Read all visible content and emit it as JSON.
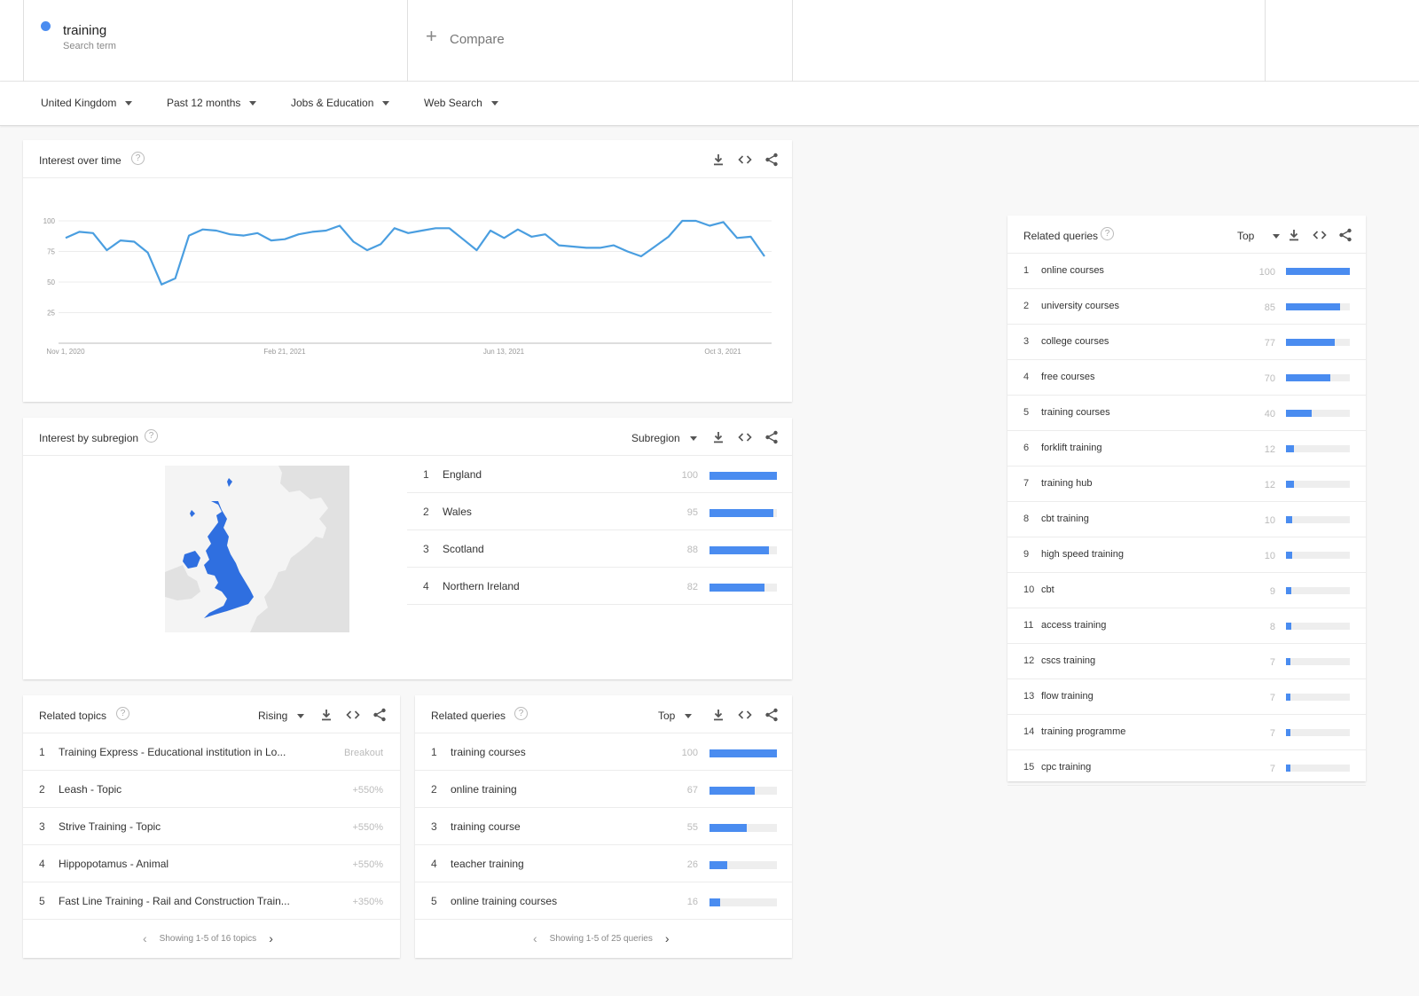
{
  "search": {
    "term": "training",
    "term_sub": "Search term",
    "compare_plus": "+",
    "compare_label": "Compare",
    "term_color": "#4a8cf0"
  },
  "filters": {
    "region": "United Kingdom",
    "period": "Past 12 months",
    "category": "Jobs & Education",
    "search_type": "Web Search"
  },
  "icons": {
    "help": "?",
    "download": "download-icon",
    "embed": "embed-icon",
    "share": "share-icon"
  },
  "interest_over_time": {
    "title": "Interest over time",
    "chart_data": {
      "type": "line",
      "x_tick_labels": [
        "Nov 1, 2020",
        "Feb 21, 2021",
        "Jun 13, 2021",
        "Oct 3, 2021"
      ],
      "y_tick_labels": [
        "100",
        "75",
        "50",
        "25"
      ],
      "ylim": [
        0,
        100
      ],
      "grid": true,
      "color": "#4a9ee0",
      "values": [
        86,
        91,
        90,
        76,
        84,
        83,
        74,
        48,
        53,
        88,
        93,
        92,
        89,
        88,
        90,
        84,
        85,
        89,
        91,
        92,
        96,
        83,
        76,
        81,
        94,
        90,
        92,
        94,
        94,
        85,
        76,
        92,
        86,
        93,
        87,
        89,
        80,
        79,
        78,
        78,
        80,
        75,
        71,
        79,
        87,
        100,
        100,
        96,
        99,
        86,
        87,
        71
      ]
    }
  },
  "interest_by_subregion": {
    "title": "Interest by subregion",
    "dropdown": "Subregion",
    "rows": [
      {
        "rank": "1",
        "name": "England",
        "value": "100",
        "score": 100
      },
      {
        "rank": "2",
        "name": "Wales",
        "value": "95",
        "score": 95
      },
      {
        "rank": "3",
        "name": "Scotland",
        "value": "88",
        "score": 88
      },
      {
        "rank": "4",
        "name": "Northern Ireland",
        "value": "82",
        "score": 82
      }
    ]
  },
  "related_topics": {
    "title": "Related topics",
    "dropdown": "Rising",
    "rows": [
      {
        "rank": "1",
        "name": "Training Express - Educational institution in Lo...",
        "value": "Breakout"
      },
      {
        "rank": "2",
        "name": "Leash - Topic",
        "value": "+550%"
      },
      {
        "rank": "3",
        "name": "Strive Training - Topic",
        "value": "+550%"
      },
      {
        "rank": "4",
        "name": "Hippopotamus - Animal",
        "value": "+550%"
      },
      {
        "rank": "5",
        "name": "Fast Line Training - Rail and Construction Train...",
        "value": "+350%"
      }
    ],
    "pager": "Showing 1-5 of 16 topics"
  },
  "related_queries_small": {
    "title": "Related queries",
    "dropdown": "Top",
    "rows": [
      {
        "rank": "1",
        "name": "training courses",
        "value": "100",
        "score": 100
      },
      {
        "rank": "2",
        "name": "online training",
        "value": "67",
        "score": 67
      },
      {
        "rank": "3",
        "name": "training course",
        "value": "55",
        "score": 55
      },
      {
        "rank": "4",
        "name": "teacher training",
        "value": "26",
        "score": 26
      },
      {
        "rank": "5",
        "name": "online training courses",
        "value": "16",
        "score": 16
      }
    ],
    "pager": "Showing 1-5 of 25 queries"
  },
  "related_queries_large": {
    "title": "Related queries",
    "dropdown": "Top",
    "rows": [
      {
        "rank": "1",
        "name": "online courses",
        "value": "100",
        "score": 100
      },
      {
        "rank": "2",
        "name": "university courses",
        "value": "85",
        "score": 85
      },
      {
        "rank": "3",
        "name": "college courses",
        "value": "77",
        "score": 77
      },
      {
        "rank": "4",
        "name": "free courses",
        "value": "70",
        "score": 70
      },
      {
        "rank": "5",
        "name": "training courses",
        "value": "40",
        "score": 40
      },
      {
        "rank": "6",
        "name": "forklift training",
        "value": "12",
        "score": 12
      },
      {
        "rank": "7",
        "name": "training hub",
        "value": "12",
        "score": 12
      },
      {
        "rank": "8",
        "name": "cbt training",
        "value": "10",
        "score": 10
      },
      {
        "rank": "9",
        "name": "high speed training",
        "value": "10",
        "score": 10
      },
      {
        "rank": "10",
        "name": "cbt",
        "value": "9",
        "score": 9
      },
      {
        "rank": "11",
        "name": "access training",
        "value": "8",
        "score": 8
      },
      {
        "rank": "12",
        "name": "cscs training",
        "value": "7",
        "score": 7
      },
      {
        "rank": "13",
        "name": "flow training",
        "value": "7",
        "score": 7
      },
      {
        "rank": "14",
        "name": "training programme",
        "value": "7",
        "score": 7
      },
      {
        "rank": "15",
        "name": "cpc training",
        "value": "7",
        "score": 7
      }
    ]
  },
  "colors": {
    "bar": "#4a8cf0",
    "map_highlight": "#2f6fe0",
    "map_land": "#e3e3e3"
  }
}
